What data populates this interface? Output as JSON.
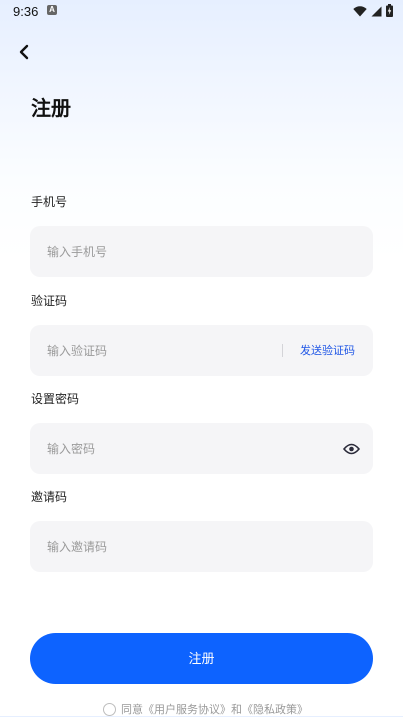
{
  "status_bar": {
    "time": "9:36",
    "app_badge": "A"
  },
  "header": {
    "title": "注册"
  },
  "form": {
    "phone": {
      "label": "手机号",
      "placeholder": "输入手机号",
      "value": ""
    },
    "code": {
      "label": "验证码",
      "placeholder": "输入验证码",
      "value": "",
      "send_label": "发送验证码"
    },
    "password": {
      "label": "设置密码",
      "placeholder": "输入密码",
      "value": ""
    },
    "invite": {
      "label": "邀请码",
      "placeholder": "输入邀请码",
      "value": ""
    }
  },
  "submit": {
    "label": "注册"
  },
  "agreement": {
    "prefix": "同意",
    "terms_link": "《用户服务协议》",
    "joiner": "和",
    "privacy_link": "《隐私政策》"
  },
  "icons": {
    "back": "chevron-left-icon",
    "wifi": "wifi-icon",
    "signal": "cell-signal-icon",
    "battery": "battery-charging-icon",
    "eye": "eye-icon"
  },
  "colors": {
    "accent": "#0d63ff",
    "link": "#2057e6",
    "input_bg": "#f5f5f7",
    "placeholder": "#9a9a9a",
    "header_gradient_top": "#e6efff"
  }
}
